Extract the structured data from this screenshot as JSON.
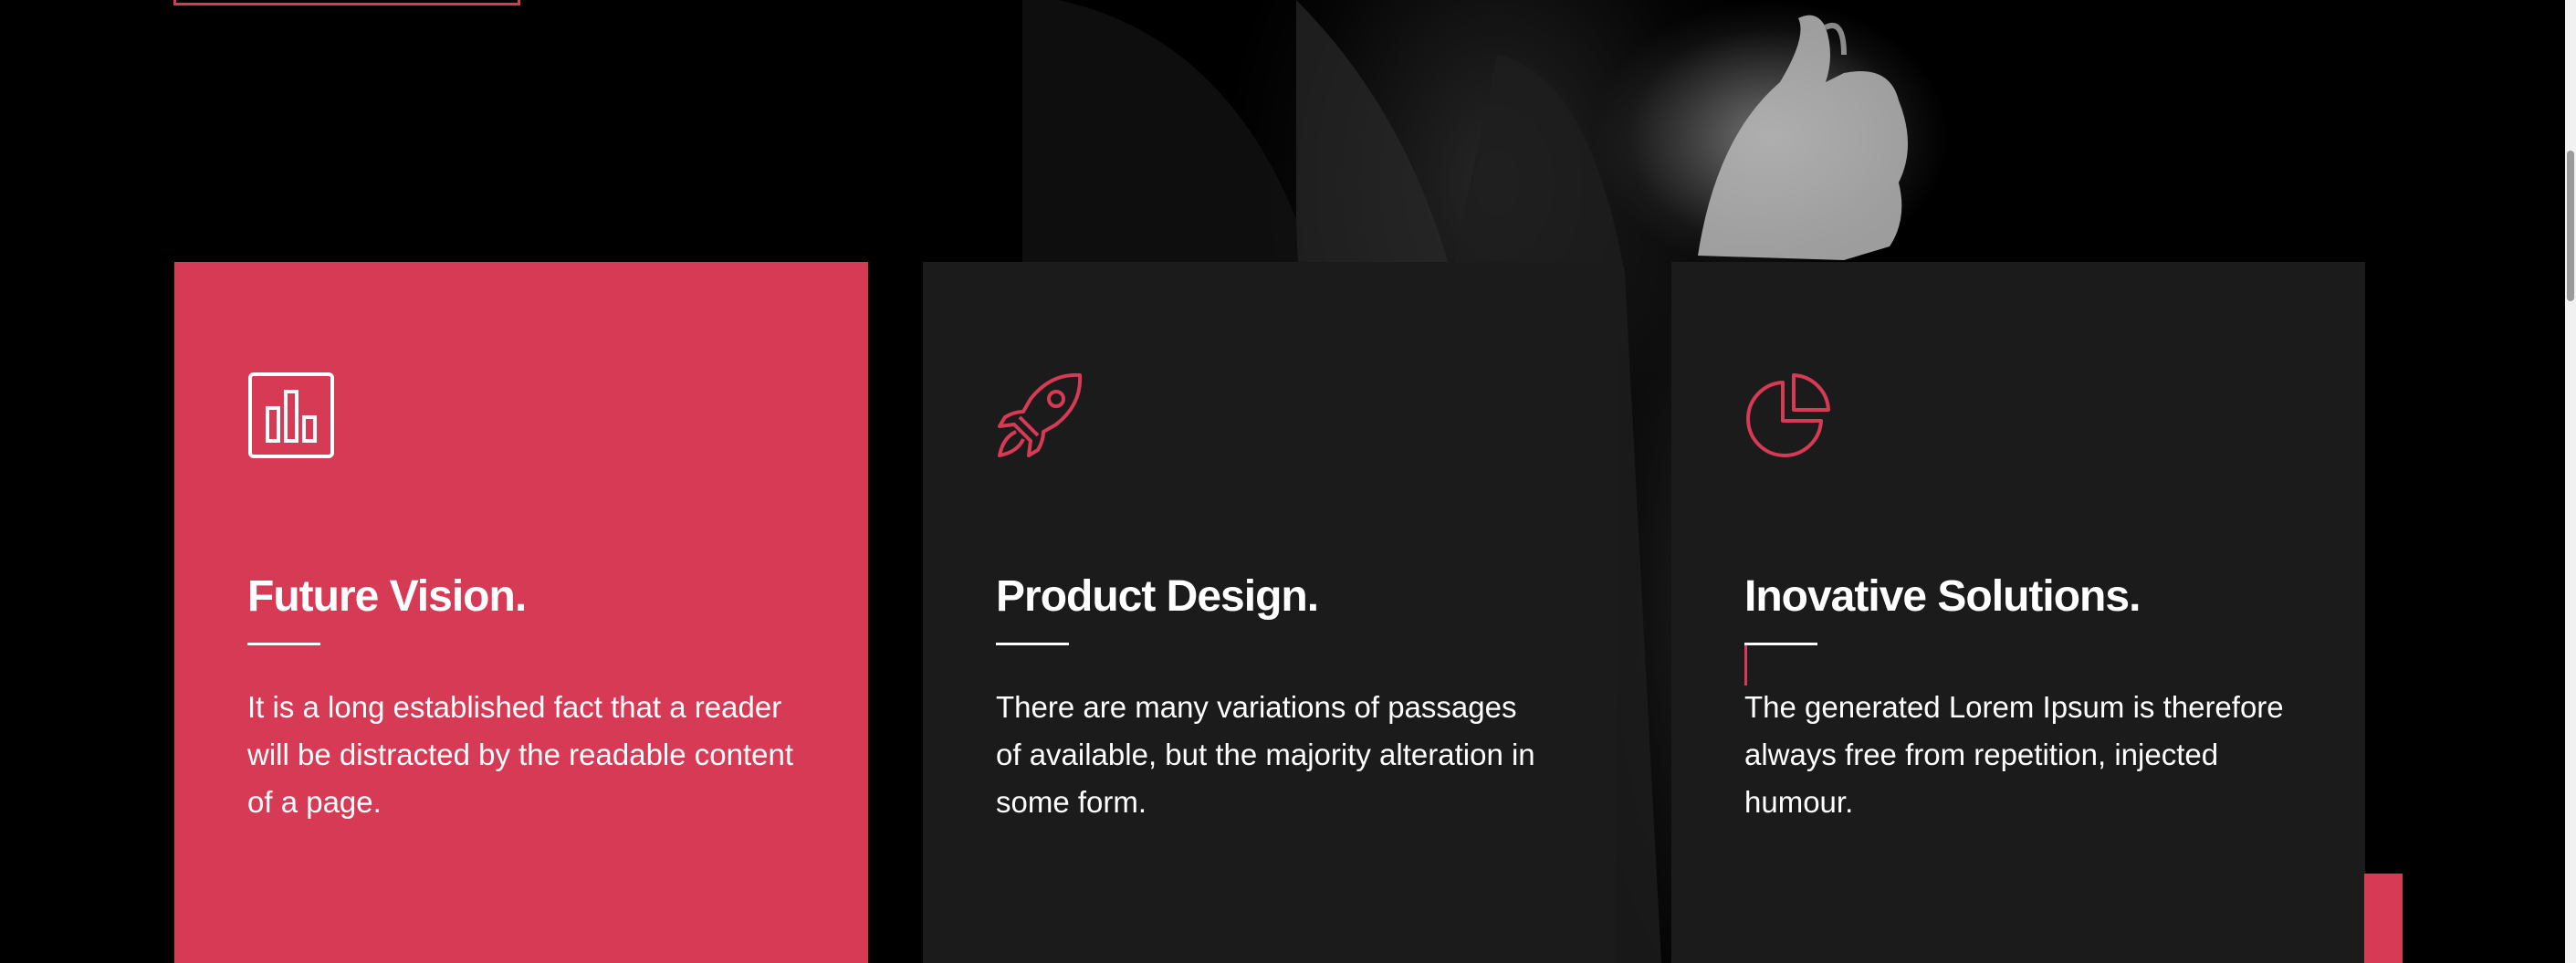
{
  "colors": {
    "accent": "#d63a55",
    "card_dark": "#1b1b1b",
    "background": "#000000",
    "text": "#ffffff"
  },
  "cards": [
    {
      "icon": "bar-chart-icon",
      "title": "Future Vision.",
      "text": "It is a long established fact that a reader will be distracted by the readable content of a page."
    },
    {
      "icon": "rocket-icon",
      "title": "Product Design.",
      "text": "There are many variations of passages of available, but the majority alteration in some form."
    },
    {
      "icon": "pie-chart-icon",
      "title": "Inovative Solutions.",
      "text": "The generated Lorem Ipsum is therefore always free from repetition, injected humour."
    }
  ]
}
